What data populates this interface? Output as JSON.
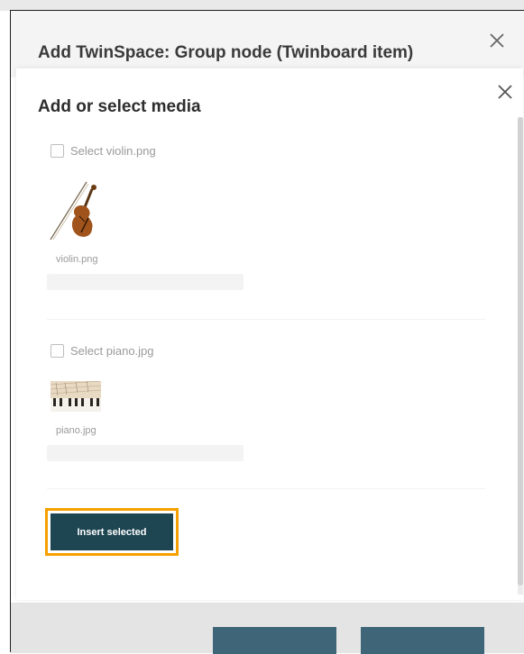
{
  "outer_dialog": {
    "title": "Add TwinSpace: Group node (Twinboard item)",
    "close_icon": "close-icon"
  },
  "media_dialog": {
    "title": "Add or select media",
    "close_icon": "close-icon",
    "items": [
      {
        "checkbox_label": "Select violin.png",
        "file_name": "violin.png",
        "thumbnail": "violin-image",
        "checked": false
      },
      {
        "checkbox_label": "Select piano.jpg",
        "file_name": "piano.jpg",
        "thumbnail": "piano-image",
        "checked": false
      }
    ],
    "insert_label": "Insert selected"
  },
  "colors": {
    "insert_button": "#1d4552",
    "focus_outline": "#f5a000",
    "footer_button": "#3f6578"
  }
}
